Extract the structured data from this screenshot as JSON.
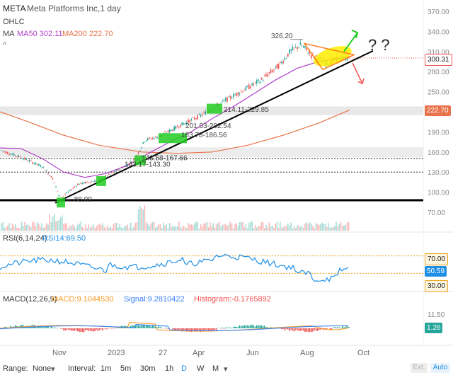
{
  "header": {
    "ticker": "META",
    "name": "Meta Platforms Inc,1 day",
    "ohlc": "OHLC",
    "ma_label": "MA",
    "ma50": "MA50 302.11",
    "ma200": "MA200 222.70",
    "chevron": "^"
  },
  "colors": {
    "up": "#26a69a",
    "down": "#ef5350",
    "ma50": "#b040c8",
    "ma200": "#e8734a",
    "trend": "#000000",
    "highlight_green": "#22cc22",
    "highlight_yellow": "#ffee00",
    "triangle": "#ff7a1a",
    "rsi": "#1f8fe6",
    "macd": "#f59a1f",
    "signal": "#3b82f6"
  },
  "price_axis": {
    "ticks": [
      "370.00",
      "340.00",
      "310.00",
      "280.00",
      "250.00",
      "220.00",
      "190.00",
      "160.00",
      "130.00",
      "100.00",
      "70.00"
    ],
    "last_price": "300.31",
    "ma200_tag": "222.70"
  },
  "annotations": {
    "high_label": "326.20",
    "low_label": "88.09",
    "zone1": "143.17-143.30",
    "zone2": "143.58-167.66",
    "zone3": "183.78-186.56",
    "zone4": "201.03-202.54",
    "zone5": "214.11-229.85",
    "question": "? ?"
  },
  "rsi": {
    "label": "RSI(6,14,24)",
    "value": "RSI14:69.50",
    "levels": [
      "70.00",
      "30.00"
    ],
    "current": "50.59"
  },
  "macd": {
    "label": "MACD(12,26,9)",
    "macd": "MACD:9.1044530",
    "signal": "Signal:9.2810422",
    "hist": "Histogram:-0.1765892",
    "axis_top": "11.50",
    "current": "1.26"
  },
  "x_axis": {
    "labels": [
      "Nov",
      "2023",
      "27",
      "Apr",
      "Jun",
      "Aug",
      "Oct"
    ]
  },
  "toolbar": {
    "range_label": "Range:",
    "range_value": "None",
    "interval_label": "Interval:",
    "intervals": [
      "1m",
      "5m",
      "30m",
      "1h",
      "D",
      "W",
      "M"
    ],
    "ext": "Ext.",
    "auto": "Auto"
  },
  "chart_data": {
    "type": "candlestick",
    "title": "META - Meta Platforms Inc, 1 day",
    "y_range": [
      70,
      370
    ],
    "x_labels": [
      "Nov",
      "2023",
      "27",
      "Apr",
      "Jun",
      "Aug",
      "Oct"
    ],
    "close_points": [
      {
        "x": "Sep 2022",
        "y": 163
      },
      {
        "x": "Oct 2022",
        "y": 135
      },
      {
        "x": "Nov 2022",
        "y": 90
      },
      {
        "x": "Dec 2022",
        "y": 118
      },
      {
        "x": "Jan 2023",
        "y": 137
      },
      {
        "x": "Feb 2023",
        "y": 185
      },
      {
        "x": "Mar 2023",
        "y": 205
      },
      {
        "x": "Apr 2023",
        "y": 240
      },
      {
        "x": "May 2023",
        "y": 262
      },
      {
        "x": "Jun 2023",
        "y": 285
      },
      {
        "x": "Jul 2023",
        "y": 318
      },
      {
        "x": "Aug 2023",
        "y": 300
      },
      {
        "x": "Sep 2023",
        "y": 300.31
      }
    ],
    "ma50_last": 302.11,
    "ma200_last": 222.7,
    "high": 326.2,
    "low": 88.09,
    "support_zones": [
      {
        "label": "143.17-143.30"
      },
      {
        "label": "143.58-167.66"
      },
      {
        "label": "183.78-186.56"
      },
      {
        "label": "201.03-202.54"
      },
      {
        "label": "214.11-229.85"
      }
    ],
    "horizontal_levels": [
      88,
      130,
      150,
      160
    ],
    "rsi14": 69.5,
    "macd": 9.104453,
    "signal": 9.2810422,
    "histogram": -0.1765892
  }
}
